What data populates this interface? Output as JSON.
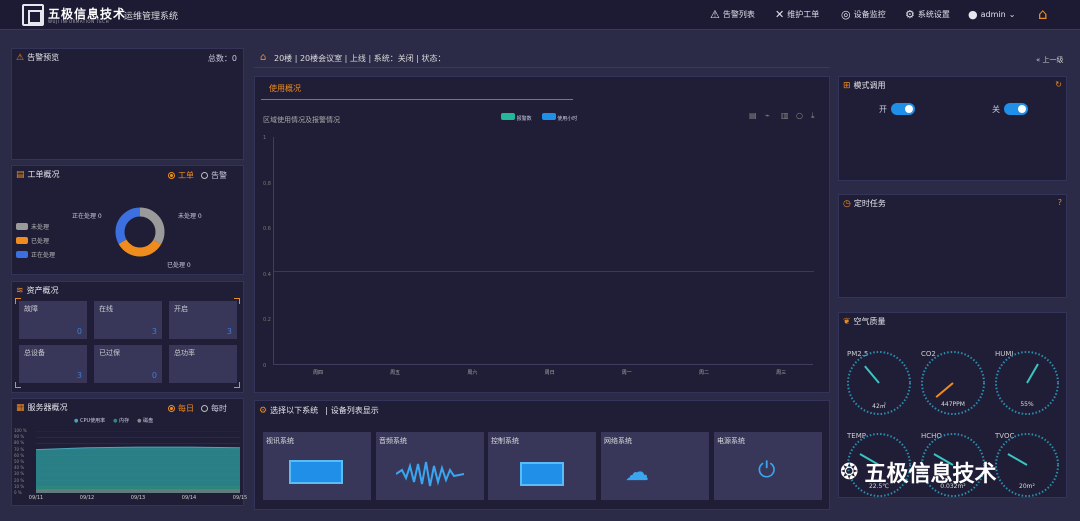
{
  "header": {
    "brand": "五极信息技术",
    "brand_sub": "WUJI INFORMATION TECH",
    "system_name": "运维管理系统",
    "nav": [
      {
        "label": "告警列表",
        "icon": "warning-icon"
      },
      {
        "label": "维护工单",
        "icon": "wrench-icon"
      },
      {
        "label": "设备监控",
        "icon": "location-icon"
      },
      {
        "label": "系统设置",
        "icon": "gear-icon"
      }
    ],
    "user": "admin"
  },
  "alarm": {
    "title": "告警预览",
    "total": "总数：0"
  },
  "workorder": {
    "title": "工单概况",
    "options": [
      "工单",
      "告警"
    ],
    "legend": [
      "未处理",
      "已处理",
      "正在处理"
    ],
    "labels": [
      "正在处理 0",
      "未处理 0",
      "已处理 0"
    ]
  },
  "assets": {
    "title": "资产概况",
    "items": [
      {
        "label": "故障",
        "value": "0"
      },
      {
        "label": "在线",
        "value": "3"
      },
      {
        "label": "开启",
        "value": "3"
      },
      {
        "label": "总设备",
        "value": "3"
      },
      {
        "label": "已过保",
        "value": "0"
      },
      {
        "label": "总功率",
        "value": ""
      }
    ]
  },
  "server": {
    "title": "服务器概况",
    "options": [
      "每日",
      "每时"
    ],
    "legend": [
      "CPU使用率",
      "内存",
      "磁盘"
    ],
    "yticks": [
      "100 %",
      "90 %",
      "80 %",
      "70 %",
      "60 %",
      "50 %",
      "40 %",
      "30 %",
      "20 %",
      "10 %",
      "0 %"
    ],
    "xticks": [
      "09/11",
      "09/12",
      "09/13",
      "09/14",
      "09/15"
    ]
  },
  "breadcrumb": "20楼 | 20楼会议室 | 上线 | 系统：关闭 | 状态：",
  "back": "上一级",
  "usage": {
    "tab": "使用概况",
    "chart_title": "区域使用情况及报警情况",
    "legend": [
      "报警数",
      "使用小时"
    ],
    "yticks": [
      "1",
      "0.8",
      "0.6",
      "0.4",
      "0.2",
      "0"
    ],
    "xticks": [
      "周四",
      "周五",
      "周六",
      "周日",
      "周一",
      "周二",
      "周三"
    ]
  },
  "systems": {
    "title": "选择以下系统",
    "subtitle": "设备列表显示",
    "items": [
      "视讯系统",
      "音频系统",
      "控制系统",
      "网络系统",
      "电源系统"
    ]
  },
  "mode": {
    "title": "模式调用",
    "on": "开",
    "off": "关"
  },
  "timer": {
    "title": "定时任务"
  },
  "air": {
    "title": "空气质量",
    "gauges": [
      {
        "label": "PM2.5",
        "value": "42㎡"
      },
      {
        "label": "CO2",
        "value": "447PPM"
      },
      {
        "label": "HUMI",
        "value": "55%"
      },
      {
        "label": "TEMP",
        "value": "22.5℃"
      },
      {
        "label": "HCHO",
        "value": "0.032m²"
      },
      {
        "label": "TVOC",
        "value": "20m²"
      }
    ]
  },
  "watermark": "五极信息技术",
  "chart_data": {
    "type": "line",
    "title": "",
    "categories": [
      "09/11",
      "09/12",
      "09/13",
      "09/14",
      "09/15"
    ],
    "series": [
      {
        "name": "CPU使用率",
        "values": [
          70,
          73,
          74,
          74,
          73
        ]
      },
      {
        "name": "内存",
        "values": [
          10,
          10,
          10,
          10,
          10
        ]
      },
      {
        "name": "磁盘",
        "values": [
          5,
          5,
          5,
          5,
          5
        ]
      }
    ],
    "ylim": [
      0,
      100
    ]
  }
}
